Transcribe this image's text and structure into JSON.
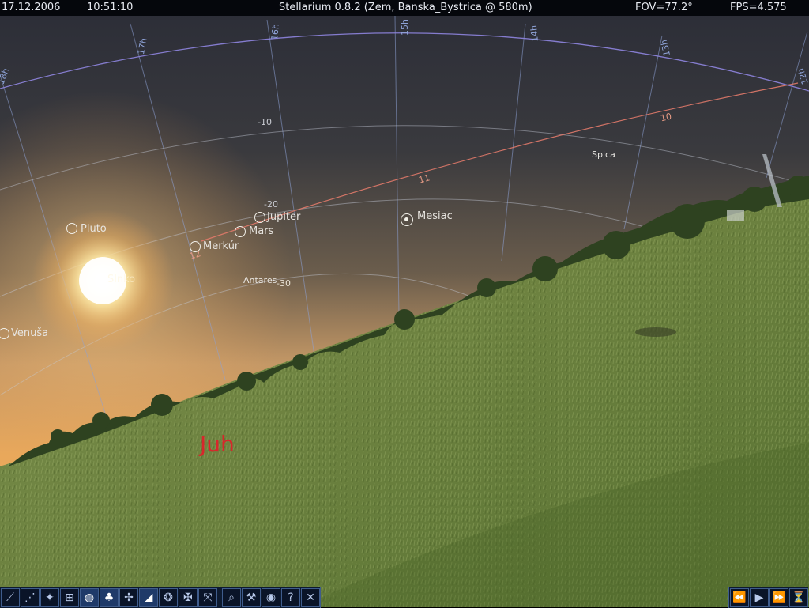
{
  "status_bar": {
    "date": "17.12.2006",
    "time": "10:51:10",
    "title": "Stellarium 0.8.2 (Zem, Banska_Bystrica @ 580m)",
    "fov": "FOV=77.2°",
    "fps": "FPS=4.575"
  },
  "sky_objects": {
    "pluto": "Pluto",
    "jupiter": "Jupiter",
    "mars": "Mars",
    "merkur": "Merkúr",
    "mesiac": "Mesiac",
    "venusa": "Venuša",
    "sun": "Slnko"
  },
  "stars": {
    "spica": "Spica",
    "antares": "Antares"
  },
  "grid_labels": {
    "ra": [
      "18h",
      "17h",
      "16h",
      "15h",
      "14h",
      "13h",
      "12h"
    ],
    "dec": [
      "-10",
      "-20",
      "-30"
    ]
  },
  "ecliptic_labels": [
    "10",
    "11",
    "12"
  ],
  "cardinal": {
    "south": "Juh"
  },
  "toolbar": {
    "left_icons": [
      "constellation-lines-icon",
      "constellation-art-icon",
      "constellation-names-icon",
      "azimuth-grid-icon",
      "equatorial-grid-icon",
      "ground-icon",
      "cardinal-points-icon",
      "atmosphere-icon",
      "nebulae-icon",
      "equatorial-mount-icon",
      "center-selection-icon"
    ],
    "active_icons": [
      "equatorial-grid-icon",
      "ground-icon",
      "atmosphere-icon"
    ],
    "right_icons": [
      "search-icon",
      "config-icon",
      "night-mode-icon",
      "help-icon",
      "quit-icon"
    ],
    "time_icons": [
      "rewind-icon",
      "play-icon",
      "fast-forward-icon",
      "now-icon"
    ]
  },
  "colors": {
    "grid": "#8ea2d6",
    "ecliptic": "#e59a84",
    "cardinal": "#d8262b",
    "toolbar_border": "#3f5c8c"
  }
}
